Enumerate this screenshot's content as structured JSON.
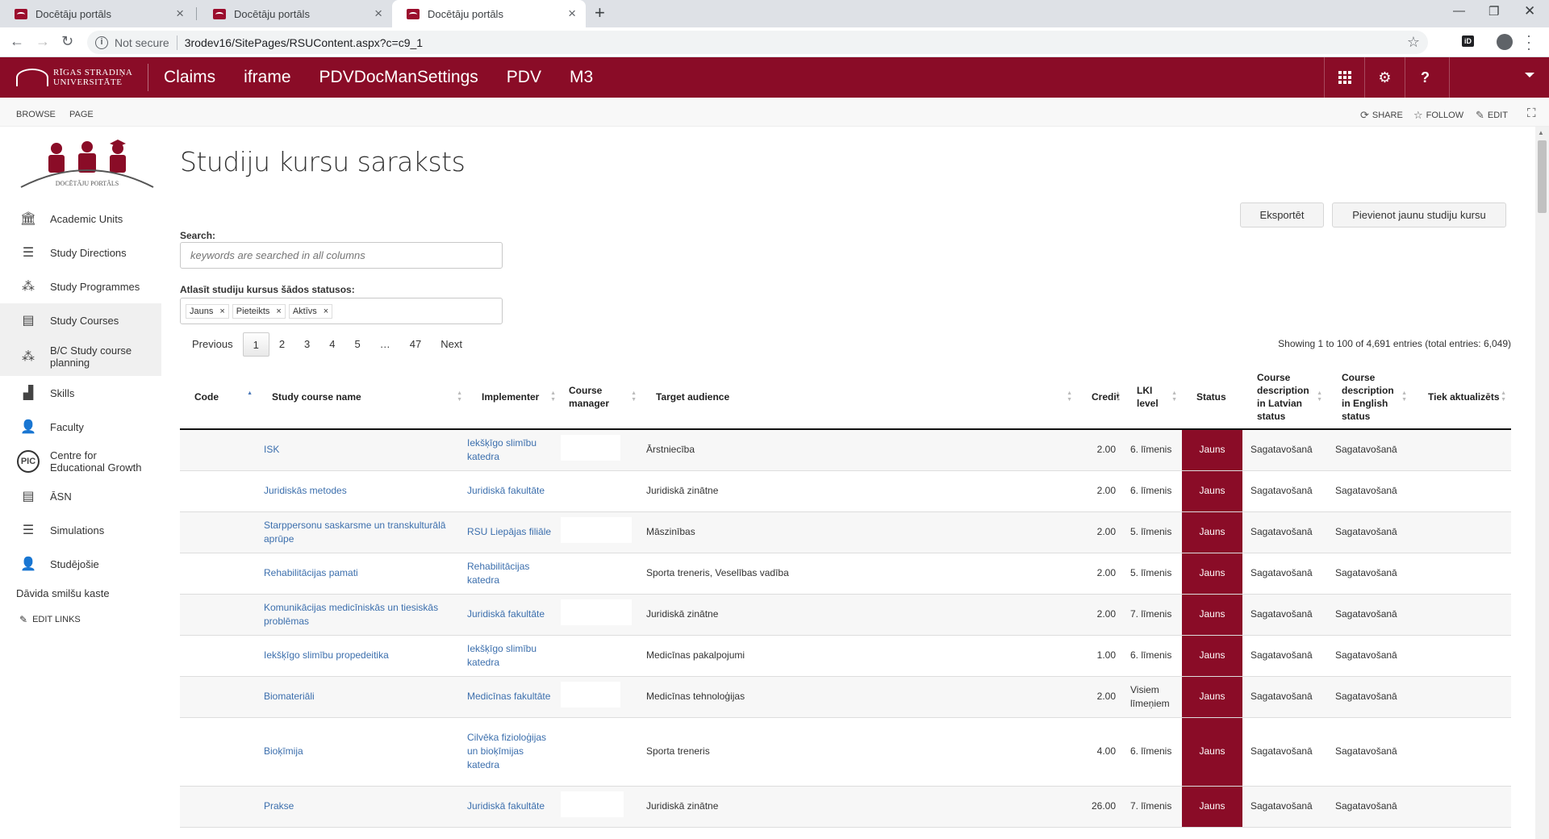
{
  "browser": {
    "tabs": [
      {
        "title": "Docētāju portāls",
        "active": false
      },
      {
        "title": "Docētāju portāls",
        "active": false
      },
      {
        "title": "Docētāju portāls",
        "active": true
      }
    ],
    "security_label": "Not secure",
    "url": "3rodev16/SitePages/RSUContent.aspx?c=c9_1",
    "extension_label": "iD"
  },
  "suitebar": {
    "logo_line1": "RĪGAS STRADIŅA",
    "logo_line2": "UNIVERSITĀTE",
    "nav": [
      "Claims",
      "iframe",
      "PDVDocManSettings",
      "PDV",
      "M3"
    ],
    "help_label": "?",
    "color": "#8a0c27"
  },
  "ribbon": {
    "tabs": [
      "BROWSE",
      "PAGE"
    ],
    "actions": {
      "share": "SHARE",
      "follow": "FOLLOW",
      "edit": "EDIT"
    }
  },
  "site_logo_text": "DOCĒTĀJU PORTĀLS",
  "leftnav": {
    "items": [
      {
        "label": "Academic Units",
        "icon": "building-icon",
        "selected": false
      },
      {
        "label": "Study Directions",
        "icon": "signpost-icon",
        "selected": false
      },
      {
        "label": "Study Programmes",
        "icon": "network-icon",
        "selected": false
      },
      {
        "label": "Study Courses",
        "icon": "books-icon",
        "selected": true
      },
      {
        "label": "B/C Study course planning",
        "icon": "network-icon",
        "selected": true
      },
      {
        "label": "Skills",
        "icon": "podium-icon",
        "selected": false
      },
      {
        "label": "Faculty",
        "icon": "teacher-icon",
        "selected": false
      },
      {
        "label": "Centre for Educational Growth",
        "icon": "pic-icon",
        "selected": false,
        "badge": "PIC"
      },
      {
        "label": "ĀSN",
        "icon": "books-icon",
        "selected": false
      },
      {
        "label": "Simulations",
        "icon": "signpost-icon",
        "selected": false
      },
      {
        "label": "Studējošie",
        "icon": "student-icon",
        "selected": false
      }
    ],
    "extra_link": "Dāvida smilšu kaste",
    "edit_links": "EDIT LINKS"
  },
  "main": {
    "title": "Studiju kursu saraksts",
    "export_button": "Eksportēt",
    "add_button": "Pievienot jaunu studiju kursu",
    "search_label": "Search:",
    "search_placeholder": "keywords are searched in all columns",
    "status_filter_label": "Atlasīt studiju kursus šādos statusos:",
    "status_tags": [
      "Jauns",
      "Pieteikts",
      "Aktīvs"
    ],
    "pager": {
      "previous": "Previous",
      "pages": [
        "1",
        "2",
        "3",
        "4",
        "5",
        "…",
        "47"
      ],
      "current": "1",
      "next": "Next"
    },
    "showing": "Showing 1 to 100 of 4,691 entries (total entries: 6,049)"
  },
  "table": {
    "columns": [
      "Code",
      "Study course name",
      "Implementer",
      "Course manager",
      "Target audience",
      "Credit",
      "LKI level",
      "Status",
      "Course description in Latvian status",
      "Course description in English status",
      "Tiek aktualizēts"
    ],
    "rows": [
      {
        "code": "",
        "name": "ISK",
        "implementer": "Iekšķīgo slimību katedra",
        "manager": "",
        "audience": "Ārstniecība",
        "credit": "2.00",
        "lki": "6. līmenis",
        "status": "Jauns",
        "lv": "Sagatavošanā",
        "en": "Sagatavošanā",
        "upd": ""
      },
      {
        "code": "",
        "name": "Juridiskās metodes",
        "implementer": "Juridiskā fakultāte",
        "manager": "",
        "audience": "Juridiskā zinātne",
        "credit": "2.00",
        "lki": "6. līmenis",
        "status": "Jauns",
        "lv": "Sagatavošanā",
        "en": "Sagatavošanā",
        "upd": ""
      },
      {
        "code": "",
        "name": "Starppersonu saskarsme un transkulturālā aprūpe",
        "implementer": "RSU Liepājas filiāle",
        "manager": "",
        "audience": "Māszinības",
        "credit": "2.00",
        "lki": "5. līmenis",
        "status": "Jauns",
        "lv": "Sagatavošanā",
        "en": "Sagatavošanā",
        "upd": ""
      },
      {
        "code": "",
        "name": "Rehabilitācijas pamati",
        "implementer": "Rehabilitācijas katedra",
        "manager": "",
        "audience": "Sporta treneris, Veselības vadība",
        "credit": "2.00",
        "lki": "5. līmenis",
        "status": "Jauns",
        "lv": "Sagatavošanā",
        "en": "Sagatavošanā",
        "upd": ""
      },
      {
        "code": "",
        "name": "Komunikācijas medicīniskās un tiesiskās problēmas",
        "implementer": "Juridiskā fakultāte",
        "manager": "",
        "audience": "Juridiskā zinātne",
        "credit": "2.00",
        "lki": "7. līmenis",
        "status": "Jauns",
        "lv": "Sagatavošanā",
        "en": "Sagatavošanā",
        "upd": ""
      },
      {
        "code": "",
        "name": "Iekšķīgo slimību propedeitika",
        "implementer": "Iekšķīgo slimību katedra",
        "manager": "",
        "audience": "Medicīnas pakalpojumi",
        "credit": "1.00",
        "lki": "6. līmenis",
        "status": "Jauns",
        "lv": "Sagatavošanā",
        "en": "Sagatavošanā",
        "upd": ""
      },
      {
        "code": "",
        "name": "Biomateriāli",
        "implementer": "Medicīnas fakultāte",
        "manager": "",
        "audience": "Medicīnas tehnoloģijas",
        "credit": "2.00",
        "lki": "Visiem līmeņiem",
        "status": "Jauns",
        "lv": "Sagatavošanā",
        "en": "Sagatavošanā",
        "upd": ""
      },
      {
        "code": "",
        "name": "Bioķīmija",
        "implementer": "Cilvēka fizioloģijas un bioķīmijas katedra",
        "manager": "",
        "audience": "Sporta treneris",
        "credit": "4.00",
        "lki": "6. līmenis",
        "status": "Jauns",
        "lv": "Sagatavošanā",
        "en": "Sagatavošanā",
        "upd": ""
      },
      {
        "code": "",
        "name": "Prakse",
        "implementer": "Juridiskā fakultāte",
        "manager": "",
        "audience": "Juridiskā zinātne",
        "credit": "26.00",
        "lki": "7. līmenis",
        "status": "Jauns",
        "lv": "Sagatavošanā",
        "en": "Sagatavošanā",
        "upd": ""
      }
    ]
  }
}
